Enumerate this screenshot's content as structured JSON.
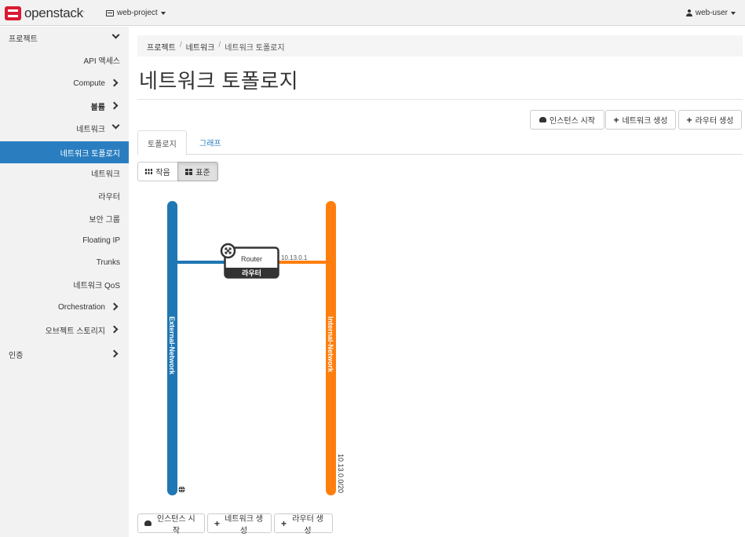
{
  "navbar": {
    "brand": "openstack",
    "brand_mark": ".",
    "project": "web-project",
    "user": "web-user"
  },
  "sidebar": {
    "items": [
      {
        "label": "프로젝트"
      },
      {
        "label": "API 액세스"
      },
      {
        "label": "Compute"
      },
      {
        "label": "볼륨"
      },
      {
        "label": "네트워크"
      },
      {
        "label": "네트워크 토폴로지"
      },
      {
        "label": "네트워크"
      },
      {
        "label": "라우터"
      },
      {
        "label": "보안 그룹"
      },
      {
        "label": "Floating IP"
      },
      {
        "label": "Trunks"
      },
      {
        "label": "네트워크 QoS"
      },
      {
        "label": "Orchestration"
      },
      {
        "label": "오브젝트 스토리지"
      },
      {
        "label": "인증"
      }
    ]
  },
  "breadcrumb": {
    "items": [
      "프로젝트",
      "네트워크",
      "네트워크 토폴로지"
    ],
    "separator": "/"
  },
  "page": {
    "title": "네트워크 토폴로지"
  },
  "actions": {
    "launch_instance": "인스턴스 시작",
    "create_network": "네트워크 생성",
    "create_router": "라우터 생성"
  },
  "tabs": [
    "토폴로지",
    "그래프"
  ],
  "view_toggle": {
    "compact": "작음",
    "normal": "표준"
  },
  "topology": {
    "networks": [
      {
        "name": "External-Network",
        "color": "#1f77b4",
        "cidr": ""
      },
      {
        "name": "Internal-Network",
        "color": "#ff7f0e",
        "cidr": "10.13.0.0/20"
      }
    ],
    "router": {
      "name": "Router",
      "type_label": "라우터",
      "internal_ip": "10.13.0.1"
    }
  }
}
